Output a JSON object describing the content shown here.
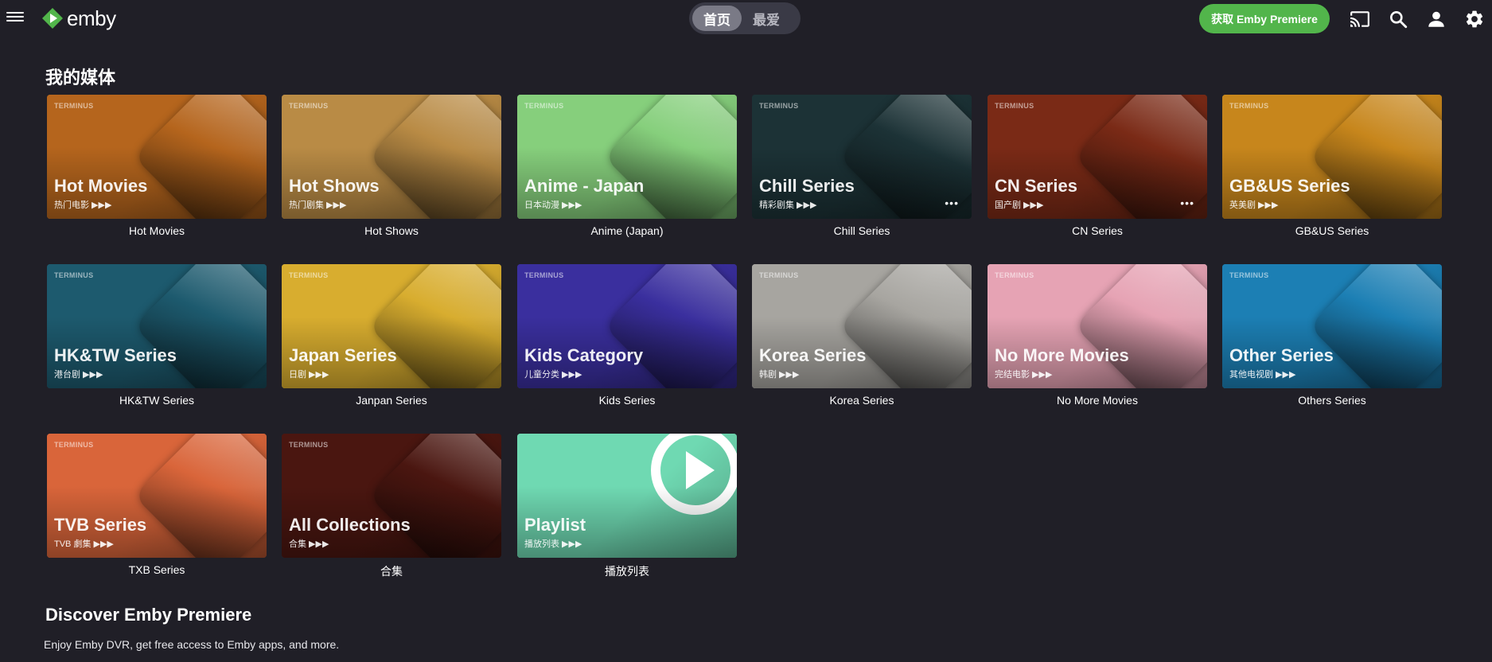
{
  "header": {
    "menu_icon": "hamburger-menu-icon",
    "logo_text": "emby",
    "tabs": [
      {
        "label": "首页",
        "active": true
      },
      {
        "label": "最爱",
        "active": false
      }
    ],
    "premiere_button": "获取 Emby Premiere",
    "icons": [
      "cast-icon",
      "search-icon",
      "user-icon",
      "settings-gear-icon"
    ]
  },
  "my_media": {
    "title": "我的媒体",
    "libraries": [
      {
        "caption": "Hot Movies",
        "tile_title": "Hot Movies",
        "tile_subtitle": "热门电影 ▶▶▶",
        "brand": "TERMINUS",
        "color": "#b5651d"
      },
      {
        "caption": "Hot Shows",
        "tile_title": "Hot Shows",
        "tile_subtitle": "热门剧集 ▶▶▶",
        "brand": "TERMINUS",
        "color": "#b98b45"
      },
      {
        "caption": "Anime (Japan)",
        "tile_title": "Anime - Japan",
        "tile_subtitle": "日本动漫 ▶▶▶",
        "brand": "TERMINUS",
        "color": "#86cf7c"
      },
      {
        "caption": "Chill Series",
        "tile_title": "Chill Series",
        "tile_subtitle": "精彩剧集 ▶▶▶",
        "brand": "TERMINUS",
        "color": "#1c3236",
        "more": "•••"
      },
      {
        "caption": "CN Series",
        "tile_title": "CN Series",
        "tile_subtitle": "国产剧 ▶▶▶",
        "brand": "TERMINUS",
        "color": "#7a2a16",
        "more": "•••"
      },
      {
        "caption": "GB&US Series",
        "tile_title": "GB&US Series",
        "tile_subtitle": "英美剧 ▶▶▶",
        "brand": "TERMINUS",
        "color": "#c7861c"
      },
      {
        "caption": "HK&TW Series",
        "tile_title": "HK&TW Series",
        "tile_subtitle": "港台剧 ▶▶▶",
        "brand": "TERMINUS",
        "color": "#1d5a6e"
      },
      {
        "caption": "Janpan Series",
        "tile_title": "Japan Series",
        "tile_subtitle": "日剧 ▶▶▶",
        "brand": "TERMINUS",
        "color": "#d8ad2f"
      },
      {
        "caption": "Kids Series",
        "tile_title": "Kids Category",
        "tile_subtitle": "儿童分类 ▶▶▶",
        "brand": "TERMINUS",
        "color": "#3a2f9e"
      },
      {
        "caption": "Korea Series",
        "tile_title": "Korea Series",
        "tile_subtitle": "韩剧 ▶▶▶",
        "brand": "TERMINUS",
        "color": "#a7a5a0"
      },
      {
        "caption": "No More Movies",
        "tile_title": "No More Movies",
        "tile_subtitle": "完结电影 ▶▶▶",
        "brand": "TERMINUS",
        "color": "#e6a3b4"
      },
      {
        "caption": "Others Series",
        "tile_title": "Other Series",
        "tile_subtitle": "其他电视剧 ▶▶▶",
        "brand": "TERMINUS",
        "color": "#1c7fb4"
      },
      {
        "caption": "TXB Series",
        "tile_title": "TVB Series",
        "tile_subtitle": "TVB 劇集 ▶▶▶",
        "brand": "TERMINUS",
        "color": "#d9653a"
      },
      {
        "caption": "合集",
        "tile_title": "All Collections",
        "tile_subtitle": "合集 ▶▶▶",
        "brand": "TERMINUS",
        "color": "#4a1610"
      },
      {
        "caption": "播放列表",
        "tile_title": "Playlist",
        "tile_subtitle": "播放列表 ▶▶▶",
        "brand": "",
        "color": "#6fd9b2",
        "icon": "play-circle-icon"
      }
    ]
  },
  "discover": {
    "title": "Discover Emby Premiere",
    "description": "Enjoy Emby DVR, get free access to Emby apps, and more."
  }
}
